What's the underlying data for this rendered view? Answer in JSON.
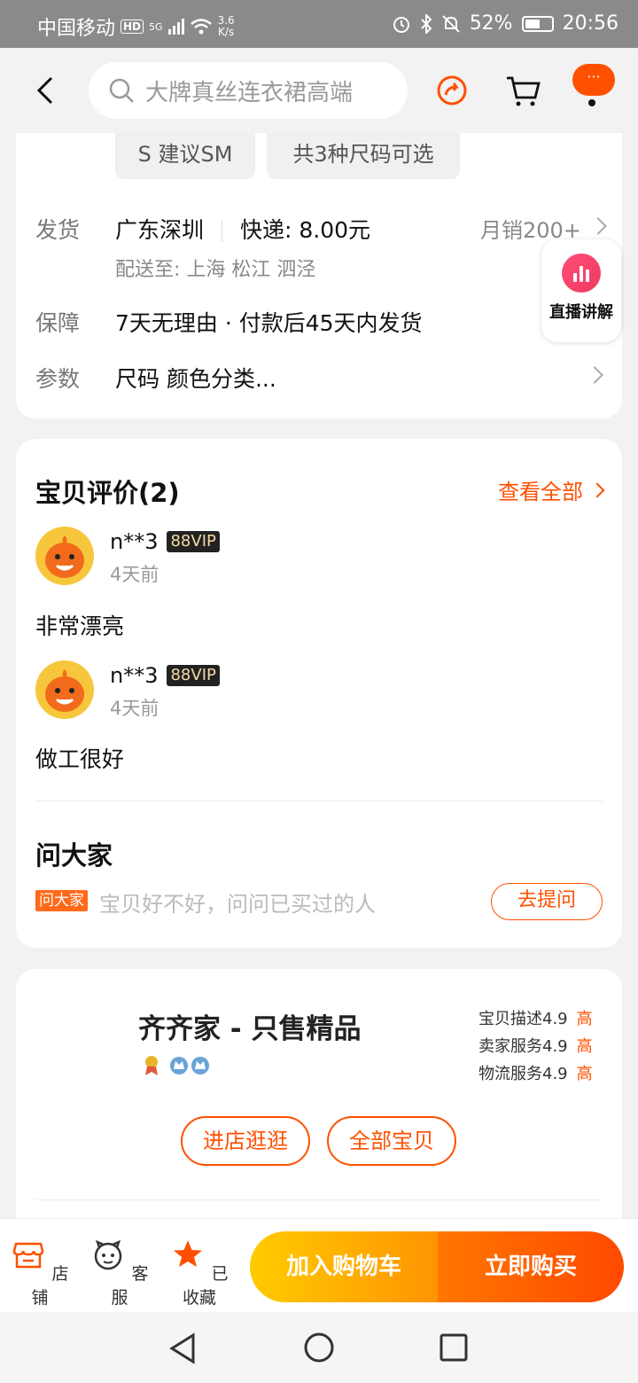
{
  "status_bar": {
    "carrier": "中国移动",
    "hd_label": "HD",
    "net_label": "5G",
    "speed_value": "3.6",
    "speed_unit": "K/s",
    "battery": "52%",
    "time": "20:56"
  },
  "top_nav": {
    "search_placeholder": "大牌真丝连衣裙高端",
    "msg_label": "···"
  },
  "spec": {
    "chips": [
      "S 建议SM",
      "共3种尺码可选"
    ],
    "ship_label": "发货",
    "ship_from": "广东深圳",
    "express": "快递: 8.00元",
    "monthly_sales": "月销200+",
    "deliver_to": "配送至: 上海 松江 泗泾",
    "guarantee_label": "保障",
    "guarantee_value": "7天无理由 · 付款后45天内发货",
    "params_label": "参数",
    "params_value": "尺码 颜色分类...",
    "live_label": "直播讲解"
  },
  "reviews": {
    "title": "宝贝评价(2)",
    "see_all": "查看全部",
    "items": [
      {
        "user": "n**3",
        "badge": "88VIP",
        "time": "4天前",
        "text": "非常漂亮"
      },
      {
        "user": "n**3",
        "badge": "88VIP",
        "time": "4天前",
        "text": "做工很好"
      }
    ]
  },
  "ask": {
    "title": "问大家",
    "tag": "问大家",
    "placeholder": "宝贝好不好，问问已买过的人",
    "button": "去提问"
  },
  "shop": {
    "name": "齐齐家 - 只售精品",
    "scores": [
      {
        "label": "宝贝描述4.9",
        "level": "高"
      },
      {
        "label": "卖家服务4.9",
        "level": "高"
      },
      {
        "label": "物流服务4.9",
        "level": "高"
      }
    ],
    "enter_button": "进店逛逛",
    "all_items_button": "全部宝贝"
  },
  "bottom_bar": {
    "tabs": [
      {
        "label": "店铺",
        "icon": "store-icon"
      },
      {
        "label": "客服",
        "icon": "customer-service-icon"
      },
      {
        "label": "已收藏",
        "icon": "star-icon"
      }
    ],
    "add_to_cart": "加入购物车",
    "buy_now": "立即购买"
  },
  "colors": {
    "accent": "#ff5000",
    "cart_gradient": [
      "#ffcb00",
      "#ff9402"
    ],
    "buy_gradient": [
      "#ff7700",
      "#ff4900"
    ]
  }
}
